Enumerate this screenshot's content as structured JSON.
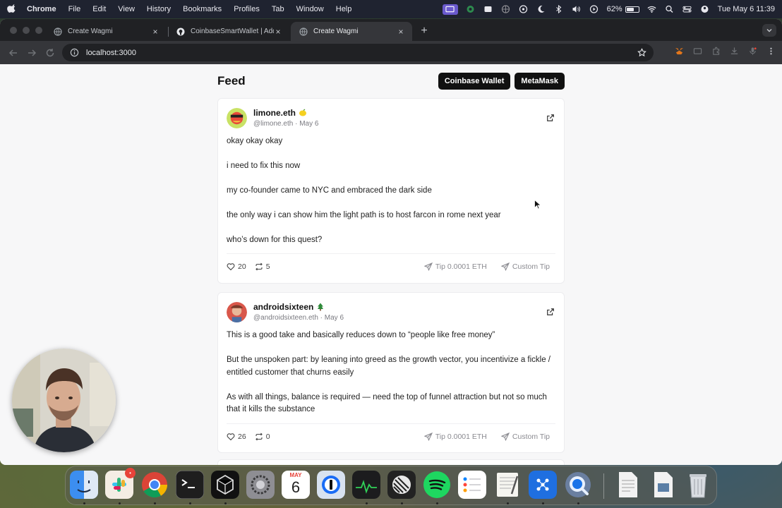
{
  "menubar": {
    "app_name": "Chrome",
    "menus": [
      "File",
      "Edit",
      "View",
      "History",
      "Bookmarks",
      "Profiles",
      "Tab",
      "Window",
      "Help"
    ],
    "battery_percent": "62%",
    "battery_level": 0.62,
    "clock": "Tue May 6  11:39"
  },
  "browser": {
    "tabs": [
      {
        "title": "Create Wagmi",
        "active": false
      },
      {
        "title": "CoinbaseSmartWallet | Addre",
        "active": false
      },
      {
        "title": "Create Wagmi",
        "active": true
      }
    ],
    "tab_close_glyph": "×",
    "new_tab_glyph": "+",
    "url": "localhost:3000"
  },
  "feed": {
    "title": "Feed",
    "wallet_buttons": [
      "Coinbase Wallet",
      "MetaMask"
    ],
    "posts": [
      {
        "display_name": "limone.eth",
        "emoji_icon": "lemon-icon",
        "handle": "@limone.eth",
        "date": "May 6",
        "separator": "·",
        "paragraphs": [
          "okay okay okay",
          "i need to fix this now",
          "my co-founder came to NYC and embraced the dark side",
          "the only way i can show him the light path is to host farcon in rome next year",
          "who’s down for this quest?"
        ],
        "likes": "20",
        "recasts": "5",
        "tip_label": "Tip 0.0001 ETH",
        "custom_tip_label": "Custom Tip"
      },
      {
        "display_name": "androidsixteen",
        "emoji_icon": "tree-icon",
        "handle": "@androidsixteen.eth",
        "date": "May 6",
        "separator": "·",
        "paragraphs": [
          "This is a good take and basically reduces down to “people like free money”",
          "But the unspoken part: by leaning into greed as the growth vector, you incentivize a fickle / entitled customer that churns easily",
          "As with all things, balance is required — need the top of funnel attraction but not so much that it kills the substance"
        ],
        "likes": "26",
        "recasts": "0",
        "tip_label": "Tip 0.0001 ETH",
        "custom_tip_label": "Custom Tip"
      }
    ]
  },
  "dock": {
    "items": [
      "finder-icon",
      "slack-icon",
      "chrome-icon",
      "terminal-icon",
      "cursor-icon",
      "system-settings-icon",
      "calendar-icon",
      "1password-icon",
      "activity-monitor-icon",
      "linear-icon",
      "spotify-icon",
      "reminders-icon",
      "textedit-icon",
      "perplexity-icon",
      "quicktime-icon",
      "document-icon",
      "preview-icon",
      "trash-icon"
    ],
    "slack_badge": "•",
    "calendar_month": "MAY",
    "calendar_day": "6"
  }
}
